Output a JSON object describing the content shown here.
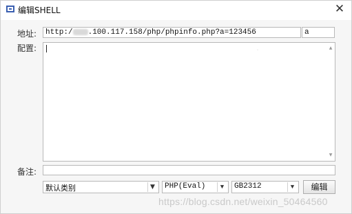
{
  "window": {
    "title": "编辑SHELL",
    "close_glyph": "✕"
  },
  "form": {
    "address_label": "地址:",
    "url_prefix": "http:/",
    "url_rest": ".100.117.158/php/phpinfo.php?a=123456",
    "password_value": "a",
    "config_label": "配置:",
    "config_value": "",
    "note_label": "备注:",
    "note_value": ""
  },
  "controls": {
    "category_selected": "默认类别",
    "type_selected": "PHP(Eval)",
    "encoding_selected": "GB2312",
    "edit_button": "编辑",
    "dropdown_glyph": "▼"
  },
  "watermark": "https://blog.csdn.net/weixin_50464560",
  "colors": {
    "accent_icon": "#3a5fb0",
    "window_bg": "#f6f6f6",
    "border": "#b8b8b8"
  },
  "icons": {
    "app": "app-window-icon",
    "close": "close-icon",
    "dropdown": "chevron-down-icon"
  }
}
